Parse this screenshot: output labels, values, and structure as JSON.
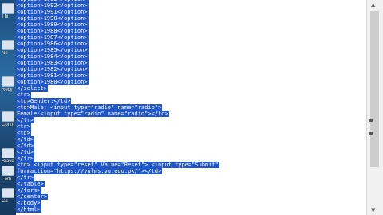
{
  "desktop_icons": [
    {
      "label": "Thi",
      "icon": "computer-icon"
    },
    {
      "label": "Ne",
      "icon": "network-icon"
    },
    {
      "label": "Recy",
      "icon": "recycle-bin-icon"
    },
    {
      "label": "Contro",
      "icon": "control-panel-icon"
    },
    {
      "label": "Brave",
      "icon": "brave-browser-icon"
    },
    {
      "label": "Forti",
      "icon": "forticlient-icon"
    },
    {
      "label": "Ca",
      "icon": "camtasia-icon"
    }
  ],
  "code_lines": [
    "<option>1993</option>",
    "<option>1992</option>",
    "<option>1991</option>",
    "<option>1990</option>",
    "<option>1989</option>",
    "<option>1988</option>",
    "<option>1987</option>",
    "<option>1986</option>",
    "<option>1985</option>",
    "<option>1984</option>",
    "<option>1983</option>",
    "<option>1982</option>",
    "<option>1981</option>",
    "<option>1980</option>",
    "</select>",
    "<tr>",
    "<td>Gender:</td>",
    "<td>Male: <input type=\"radio\" name=\"radio\">",
    "Female:<input type=\"radio\" name=\"radio\"></td>",
    "</tr>",
    "<tr>",
    "<td>",
    "</td>",
    "</td>",
    "</td>",
    "</tr>",
    "<td> <input type=\"reset\" Value=\"Reset\"> <input type=\"Submit\"",
    "formaction=\"https://vulms.vu.edu.pk/\"></td>",
    "</tr>",
    "</table>",
    "</form>",
    "</center>",
    "</body>",
    "</html>"
  ],
  "colors": {
    "selection": "#1f56c8",
    "selected_text": "#ffffff"
  }
}
